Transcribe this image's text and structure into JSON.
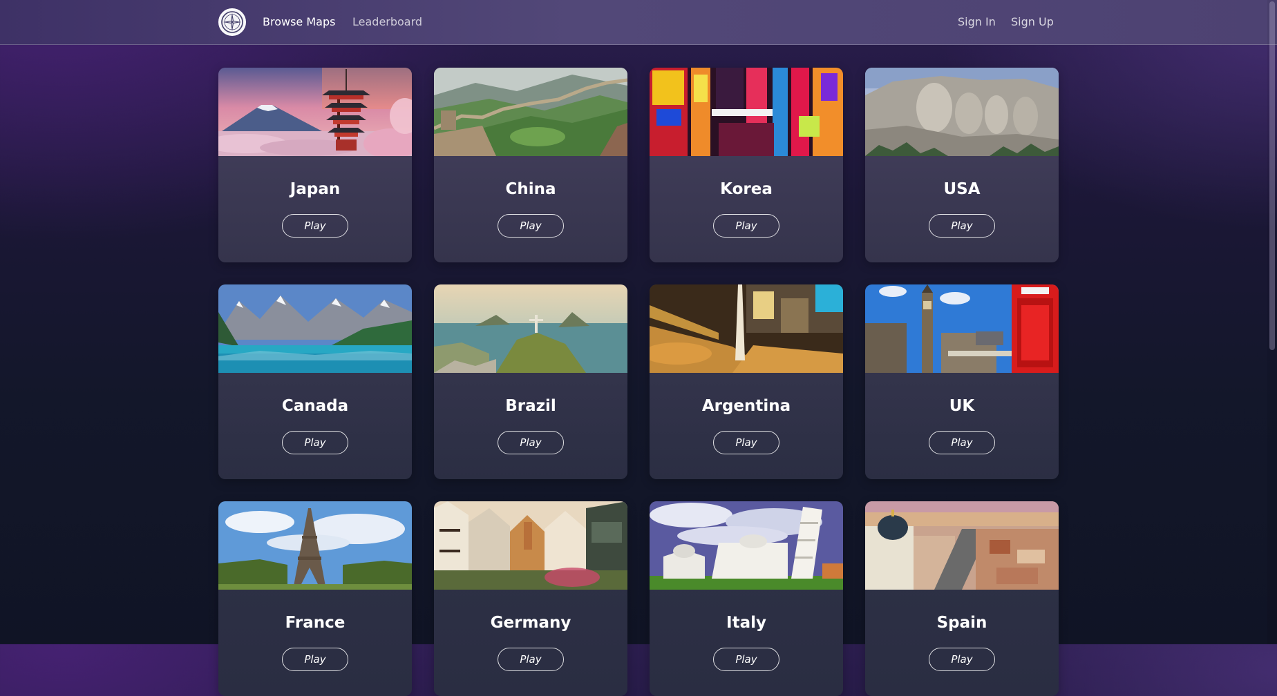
{
  "nav": {
    "logo_icon": "compass-icon",
    "browse_label": "Browse Maps",
    "leaderboard_label": "Leaderboard",
    "signin_label": "Sign In",
    "signup_label": "Sign Up"
  },
  "cards": [
    {
      "title": "Japan",
      "play_label": "Play",
      "image": "japan-pagoda-fuji"
    },
    {
      "title": "China",
      "play_label": "Play",
      "image": "china-great-wall"
    },
    {
      "title": "Korea",
      "play_label": "Play",
      "image": "korea-neon-street"
    },
    {
      "title": "USA",
      "play_label": "Play",
      "image": "usa-mount-rushmore"
    },
    {
      "title": "Canada",
      "play_label": "Play",
      "image": "canada-mountain-lake"
    },
    {
      "title": "Brazil",
      "play_label": "Play",
      "image": "brazil-christ-redeemer"
    },
    {
      "title": "Argentina",
      "play_label": "Play",
      "image": "argentina-obelisk-night"
    },
    {
      "title": "UK",
      "play_label": "Play",
      "image": "uk-big-ben-phone-box"
    },
    {
      "title": "France",
      "play_label": "Play",
      "image": "france-eiffel-tower"
    },
    {
      "title": "Germany",
      "play_label": "Play",
      "image": "germany-old-town"
    },
    {
      "title": "Italy",
      "play_label": "Play",
      "image": "italy-pisa-tower"
    },
    {
      "title": "Spain",
      "play_label": "Play",
      "image": "spain-madrid-rooftops"
    }
  ],
  "colors": {
    "nav_bg": "#4d4272",
    "page_bg_top": "#2b1d4e",
    "page_bg_bottom": "#101425",
    "card_bg": "#3d3a55"
  }
}
